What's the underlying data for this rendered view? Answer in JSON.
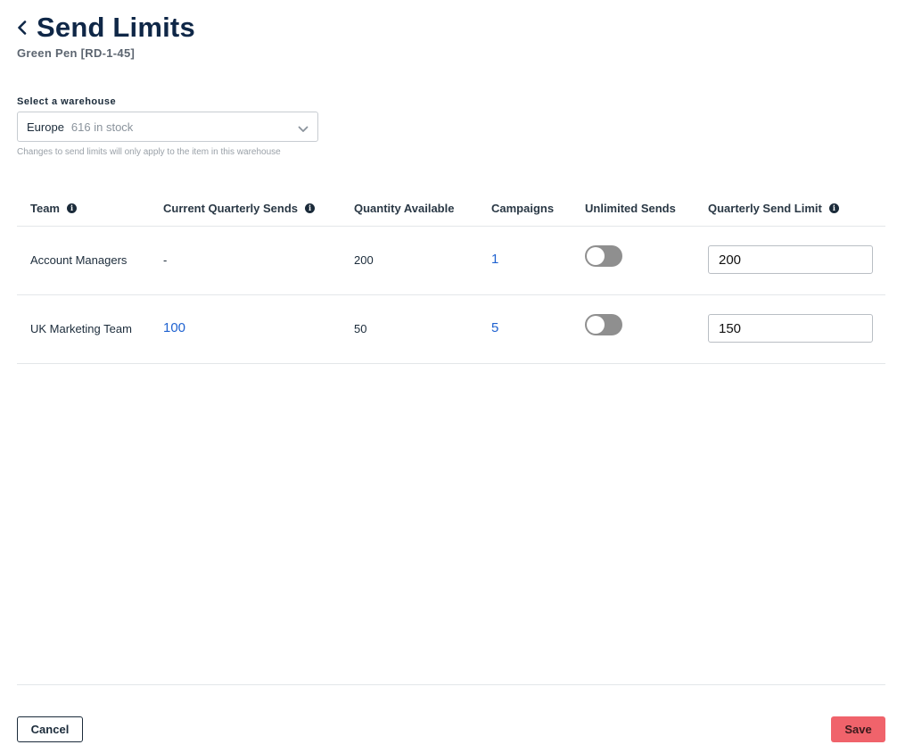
{
  "header": {
    "title": "Send Limits",
    "subtitle": "Green Pen [RD-1-45]",
    "back_icon": "chevron-left-icon"
  },
  "warehouse": {
    "label": "Select a warehouse",
    "selected_name": "Europe",
    "selected_stock": "616 in stock",
    "help_text": "Changes to send limits will only apply to the item in this warehouse"
  },
  "table": {
    "columns": {
      "team": "Team",
      "current_quarterly_sends": "Current Quarterly Sends",
      "quantity_available": "Quantity Available",
      "campaigns": "Campaigns",
      "unlimited_sends": "Unlimited Sends",
      "quarterly_send_limit": "Quarterly Send Limit"
    },
    "rows": [
      {
        "team": "Account Managers",
        "current_quarterly_sends": "-",
        "quantity_available": "200",
        "campaigns": "1",
        "unlimited_sends": false,
        "quarterly_send_limit": "200"
      },
      {
        "team": "UK Marketing Team",
        "current_quarterly_sends": "100",
        "quantity_available": "50",
        "campaigns": "5",
        "unlimited_sends": false,
        "quarterly_send_limit": "150"
      }
    ]
  },
  "footer": {
    "cancel_label": "Cancel",
    "save_label": "Save"
  },
  "colors": {
    "title": "#0f2747",
    "link": "#1f62d0",
    "save_button": "#f0636b",
    "toggle_off": "#8f8f8f"
  }
}
